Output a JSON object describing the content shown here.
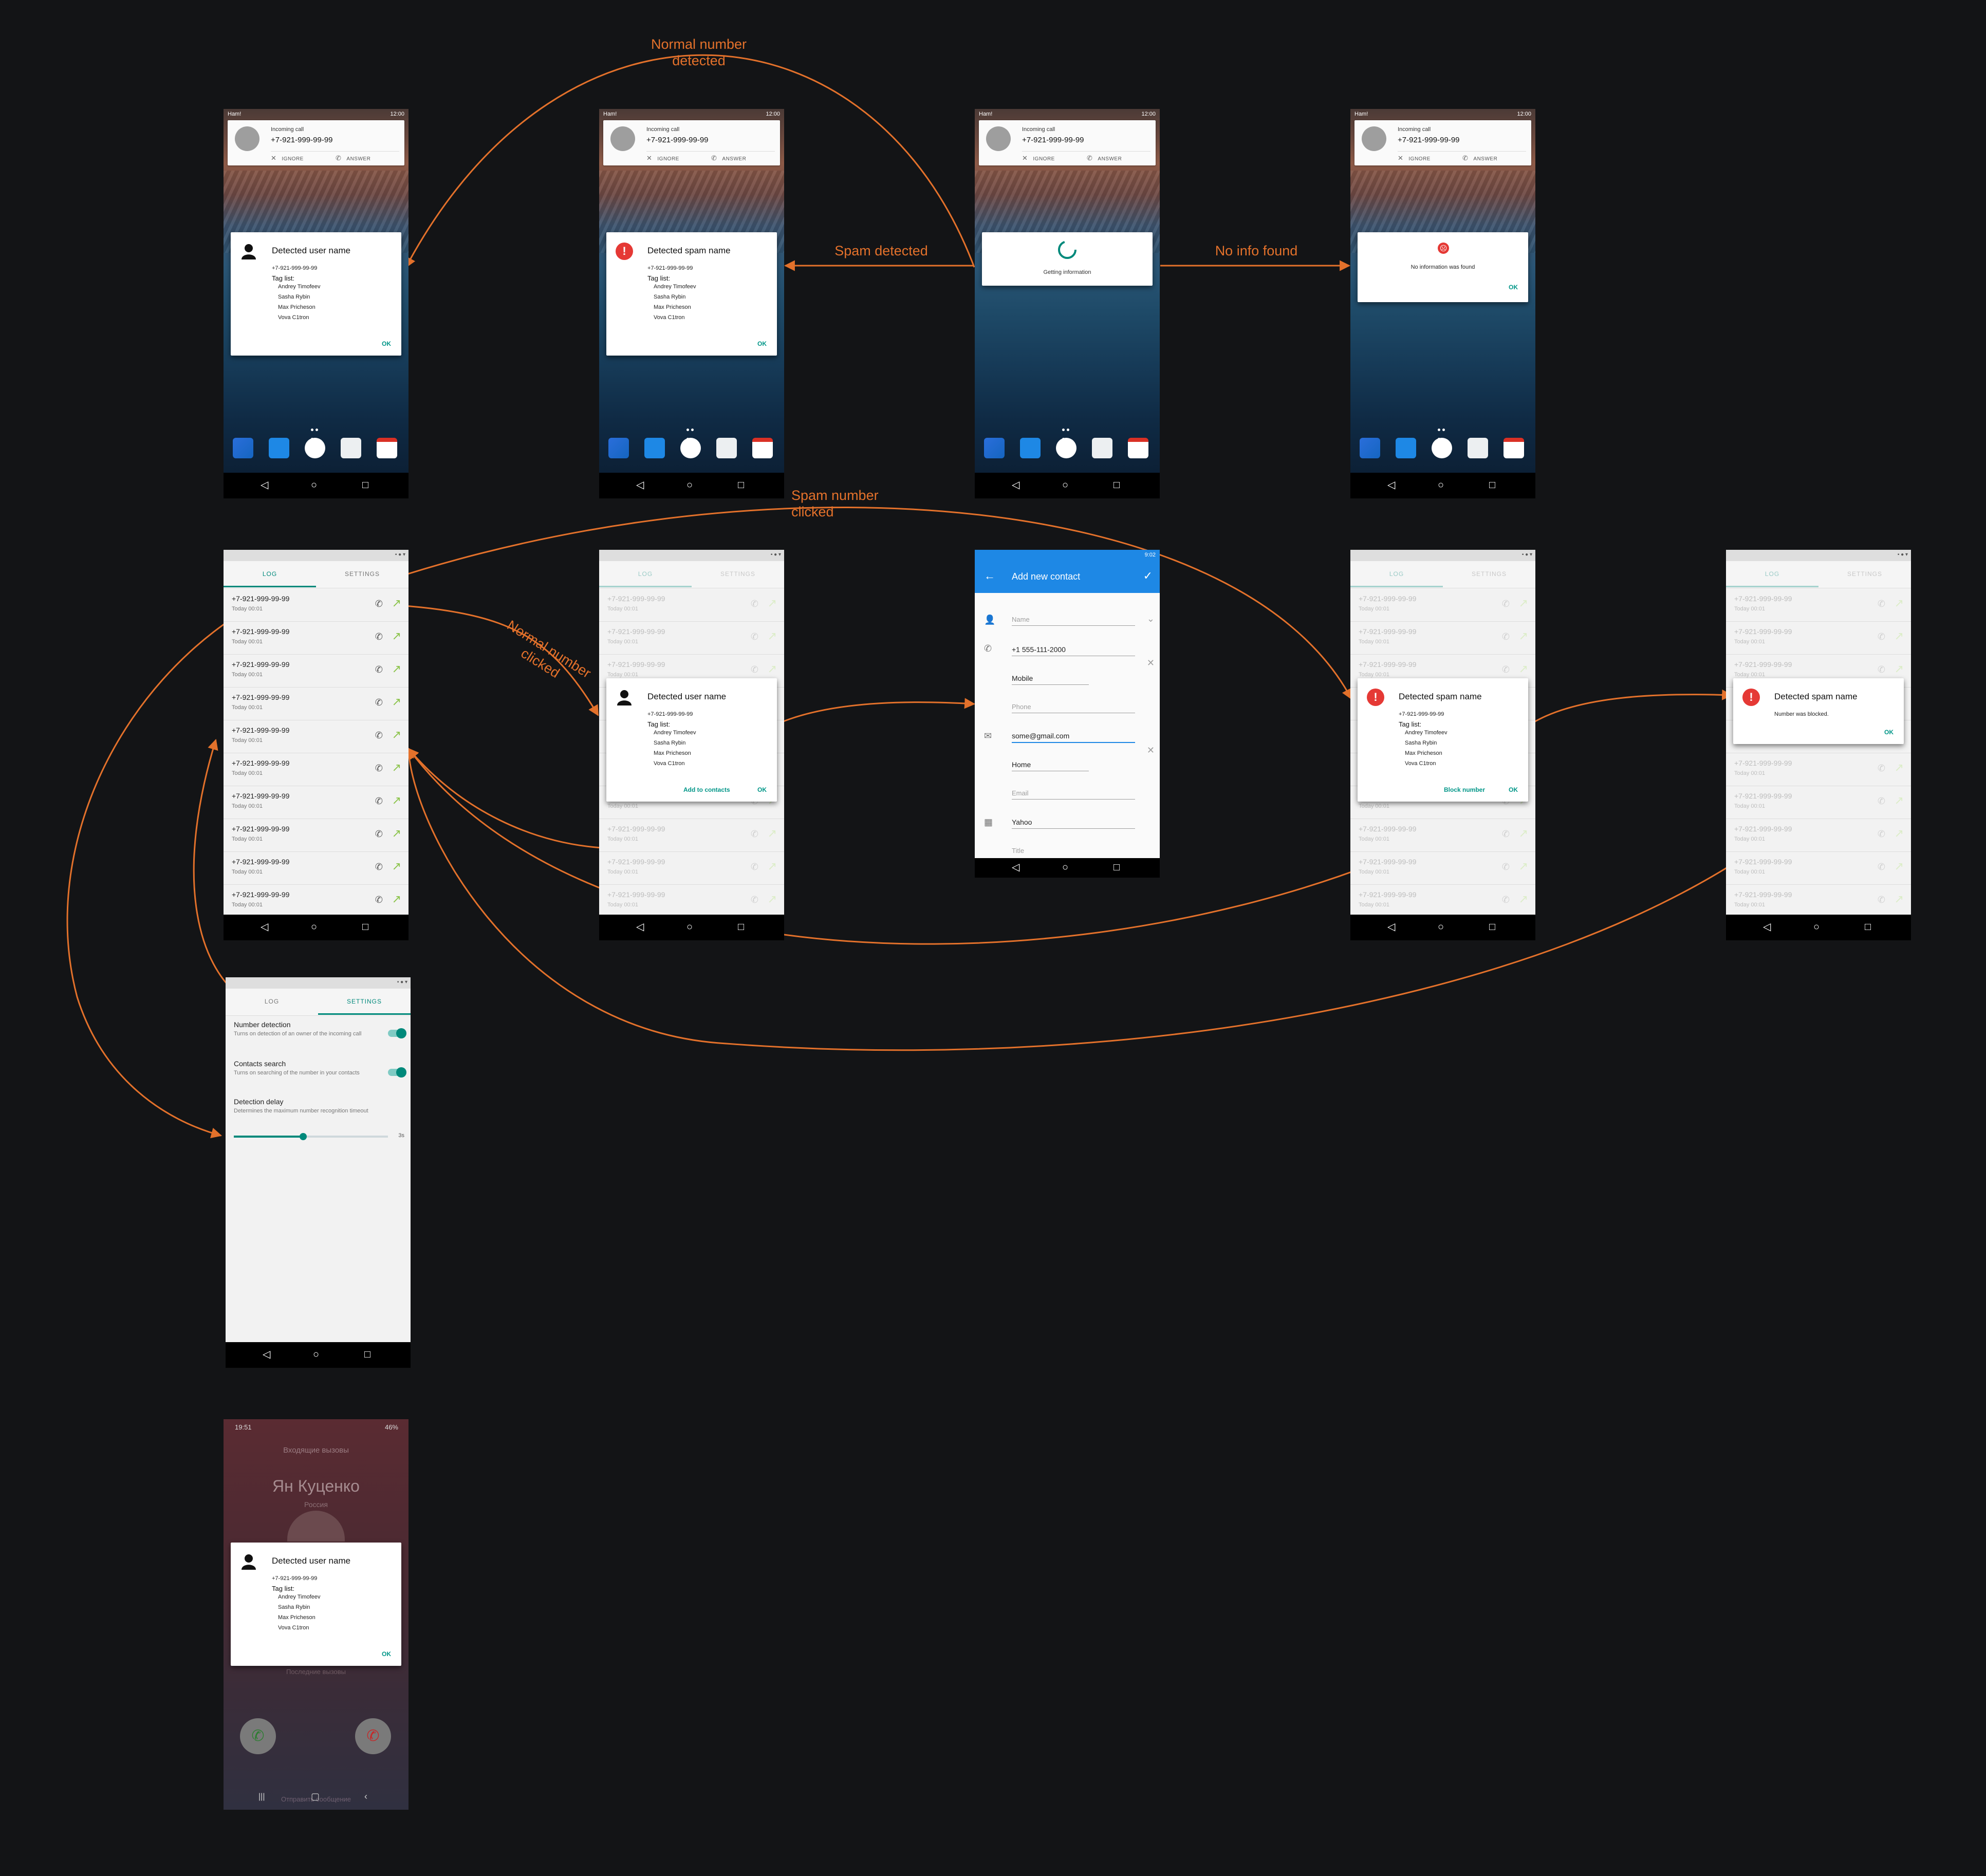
{
  "annotations": {
    "normal_detected": [
      "Normal number",
      "detected"
    ],
    "spam_detected": "Spam detected",
    "no_info": "No info found",
    "spam_clicked": [
      "Spam number",
      "clicked"
    ],
    "normal_clicked": [
      "Normal number",
      "clicked"
    ]
  },
  "accent_color": "#e3712b",
  "incoming": {
    "carrier": "Ham!",
    "time": "12:00",
    "label": "Incoming call",
    "number": "+7-921-999-99-99",
    "ignore": "IGNORE",
    "answer": "ANSWER"
  },
  "user_dialog": {
    "title": "Detected user name",
    "number": "+7-921-999-99-99",
    "tag_label": "Tag list:",
    "tags": [
      "Andrey Timofeev",
      "Sasha Rybin",
      "Max Pricheson",
      "Vova C1tron"
    ],
    "ok": "OK",
    "add_contacts": "Add to contacts"
  },
  "spam_dialog": {
    "title": "Detected spam name",
    "number": "+7-921-999-99-99",
    "tag_label": "Tag list:",
    "tags": [
      "Andrey Timofeev",
      "Sasha Rybin",
      "Max Pricheson",
      "Vova C1tron"
    ],
    "ok": "OK",
    "block": "Block number",
    "blocked_msg": "Number was blocked."
  },
  "loading": {
    "text": "Getting information"
  },
  "noinfo": {
    "text": "No information was found",
    "ok": "OK"
  },
  "log": {
    "tab_log": "LOG",
    "tab_settings": "SETTINGS",
    "number": "+7-921-999-99-99",
    "time": "Today 00:01"
  },
  "contact": {
    "title": "Add new contact",
    "time": "9:02",
    "name_ph": "Name",
    "phone_value": "+1 555-111-2000",
    "phone_type": "Mobile",
    "phone_ph": "Phone",
    "email_value": "some@gmail.com",
    "email_type": "Home",
    "email_ph": "Email",
    "company_value": "Yahoo",
    "title_ph": "Title"
  },
  "settings": {
    "detection_title": "Number detection",
    "detection_sub": "Turns on detection of an owner of the incoming call",
    "contacts_title": "Contacts search",
    "contacts_sub": "Turns on searching of the number in your contacts",
    "delay_title": "Detection delay",
    "delay_sub": "Determines the maximum number recognition timeout",
    "delay_value": "3s",
    "delay_fraction": 0.45
  },
  "samsung": {
    "status_time": "19:51",
    "status_right": "46%",
    "header": "Входящие вызовы",
    "name": "Ян Куценко",
    "country": "Россия",
    "recent": "Последние вызовы",
    "send": "Отправить сообщение"
  }
}
